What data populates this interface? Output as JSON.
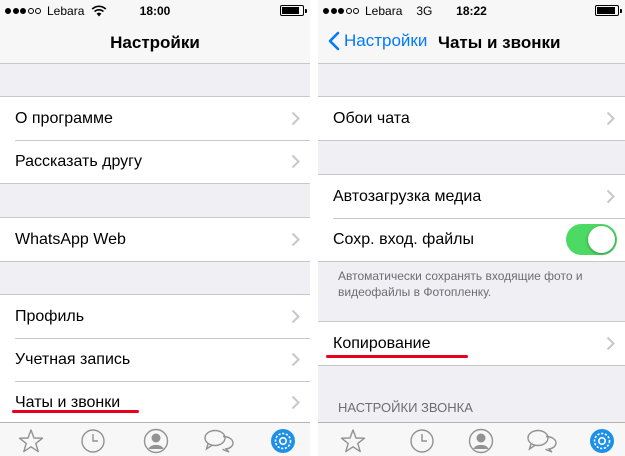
{
  "left": {
    "status": {
      "carrier": "Lebara",
      "time": "18:00",
      "battery_level": 0.85
    },
    "nav": {
      "title": "Настройки"
    },
    "group1": [
      "О программе",
      "Рассказать другу"
    ],
    "group2": [
      "WhatsApp Web"
    ],
    "group3": [
      "Профиль",
      "Учетная запись",
      "Чаты и звонки"
    ]
  },
  "right": {
    "status": {
      "carrier": "Lebara",
      "network": "3G",
      "time": "18:22",
      "battery_level": 0.9
    },
    "nav": {
      "back_label": "Настройки",
      "title": "Чаты и звонки"
    },
    "wallpaper_row": "Обои чата",
    "media_autoload_row": "Автозагрузка медиа",
    "save_incoming_row": {
      "label": "Сохр. вход. файлы",
      "toggle_on": true
    },
    "save_incoming_note": "Автоматически сохранять входящие фото и видеофайлы в Фотопленку.",
    "backup_row": "Копирование",
    "section_header": "НАСТРОЙКИ ЗВОНКА"
  },
  "tab_bar_icons": [
    "star-icon",
    "clock-icon",
    "person-icon",
    "chat-bubbles-icon",
    "settings-gear-icon"
  ],
  "colors": {
    "accent_blue": "#007aff",
    "toggle_green": "#4cd964",
    "highlight_red": "#e8001c",
    "tab_active": "#1e90e6",
    "tab_inactive": "#929292"
  }
}
